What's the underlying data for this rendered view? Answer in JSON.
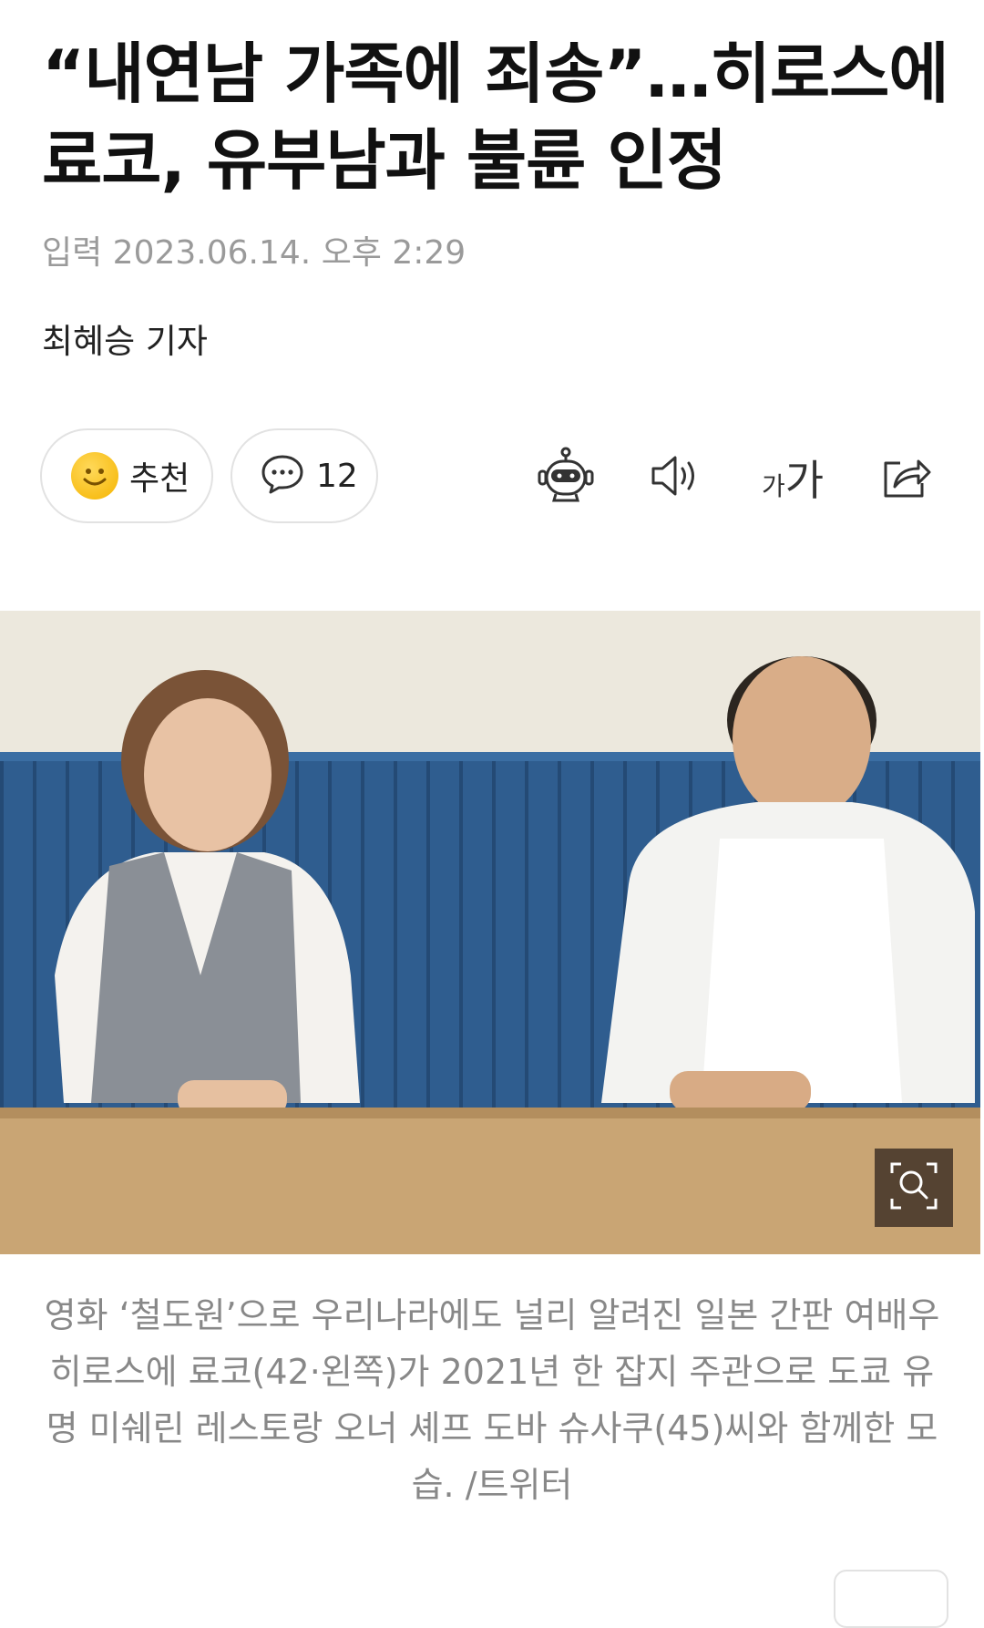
{
  "article": {
    "title": "“내연남 가족에 죄송”…히로스에 료코, 유부남과 불륜 인정",
    "date": "입력 2023.06.14. 오후 2:29",
    "author": "최혜승 기자"
  },
  "actions": {
    "recommend_label": "추천",
    "comment_count": "12",
    "font_size_small": "가",
    "font_size_large": "가"
  },
  "icons": {
    "recommend": "smiley-icon",
    "comment": "speech-bubble-icon",
    "ai_summary": "robot-icon",
    "read_aloud": "speaker-icon",
    "share": "share-icon",
    "zoom": "zoom-icon"
  },
  "photo": {
    "caption": "영화 ‘철도원’으로 우리나라에도 널리 알려진 일본 간판 여배우 히로스에 료코(42·왼쪽)가 2021년 한 잡지 주관으로 도쿄 유명 미쉐린 레스토랑 오너 셰프 도바 슈사쿠(45)씨와 함께한 모습. /트위터"
  },
  "colors": {
    "wall": "#2f5d8f",
    "table": "#c9a574",
    "accent": "#f5b400"
  }
}
